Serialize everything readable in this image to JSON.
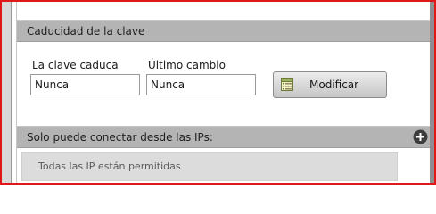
{
  "expiry_section": {
    "title": "Caducidad de la clave",
    "expires_label": "La clave caduca",
    "expires_value": "Nunca",
    "last_change_label": "Último cambio",
    "last_change_value": "Nunca",
    "modify_button_label": "Modificar",
    "modify_icon": "edit-form-icon"
  },
  "ip_section": {
    "title": "Solo puede conectar desde las IPs:",
    "add_icon": "plus-circle-icon",
    "empty_text": "Todas las IP están permitidas"
  },
  "colors": {
    "frame_border": "#e01818",
    "header_bg": "#b4b4b4",
    "list_bg": "#dcdcdc",
    "button_bg": "#d6d6d6"
  }
}
